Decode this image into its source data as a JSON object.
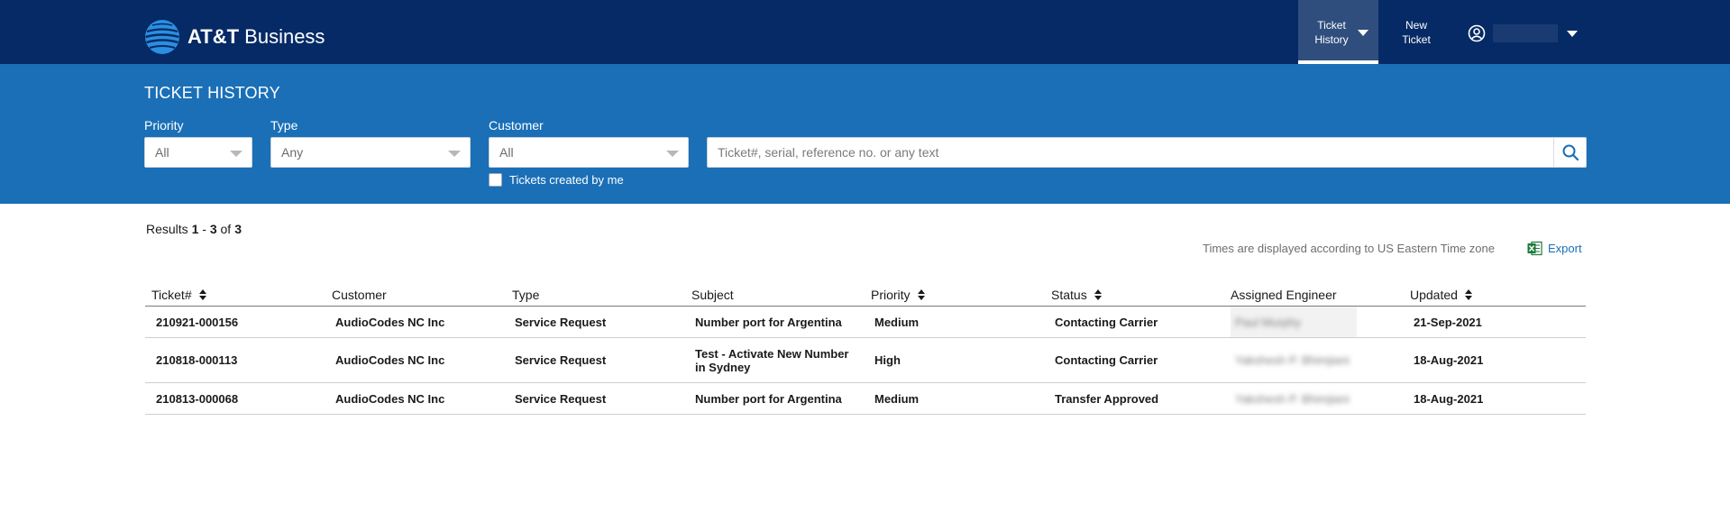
{
  "brand": {
    "att": "AT&T",
    "business": "Business"
  },
  "nav": {
    "ticket_history_line1": "Ticket",
    "ticket_history_line2": "History",
    "new_ticket_line1": "New",
    "new_ticket_line2": "Ticket"
  },
  "filters": {
    "title": "TICKET HISTORY",
    "priority_label": "Priority",
    "priority_value": "All",
    "type_label": "Type",
    "type_value": "Any",
    "customer_label": "Customer",
    "customer_value": "All",
    "created_by_me_label": "Tickets created by me",
    "search_placeholder": "Ticket#, serial, reference no. or any text"
  },
  "results": {
    "prefix": "Results",
    "from": "1",
    "dash": "-",
    "to": "3",
    "of": "of",
    "total": "3"
  },
  "timezone_note": "Times are displayed according to US Eastern Time zone",
  "export_label": "Export",
  "table": {
    "headers": {
      "ticket": "Ticket#",
      "customer": "Customer",
      "type": "Type",
      "subject": "Subject",
      "priority": "Priority",
      "status": "Status",
      "engineer": "Assigned Engineer",
      "updated": "Updated"
    },
    "rows": [
      {
        "ticket": "210921-000156",
        "customer": "AudioCodes NC Inc",
        "type": "Service Request",
        "subject_line1": "Number port for Argentina",
        "subject_line2": "",
        "priority": "Medium",
        "status": "Contacting Carrier",
        "engineer": "Paul Murphy",
        "updated": "21-Sep-2021"
      },
      {
        "ticket": "210818-000113",
        "customer": "AudioCodes NC Inc",
        "type": "Service Request",
        "subject_line1": "Test - Activate New Number",
        "subject_line2": "in Sydney",
        "priority": "High",
        "status": "Contacting Carrier",
        "engineer": "Yakshesh P. Bhimjiani",
        "updated": "18-Aug-2021"
      },
      {
        "ticket": "210813-000068",
        "customer": "AudioCodes NC Inc",
        "type": "Service Request",
        "subject_line1": "Number port for Argentina",
        "subject_line2": "",
        "priority": "Medium",
        "status": "Transfer Approved",
        "engineer": "Yakshesh P. Bhimjiani",
        "updated": "18-Aug-2021"
      }
    ]
  },
  "colors": {
    "topbar": "#062a65",
    "filter_band": "#1a6fb7",
    "active_nav": "#2f4e7e",
    "link": "#1a6fb7",
    "excel_green": "#1d7a3a"
  },
  "icons": [
    "att-globe-icon",
    "chevron-down-icon",
    "user-circle-icon",
    "search-icon",
    "excel-icon",
    "sort-icon"
  ]
}
